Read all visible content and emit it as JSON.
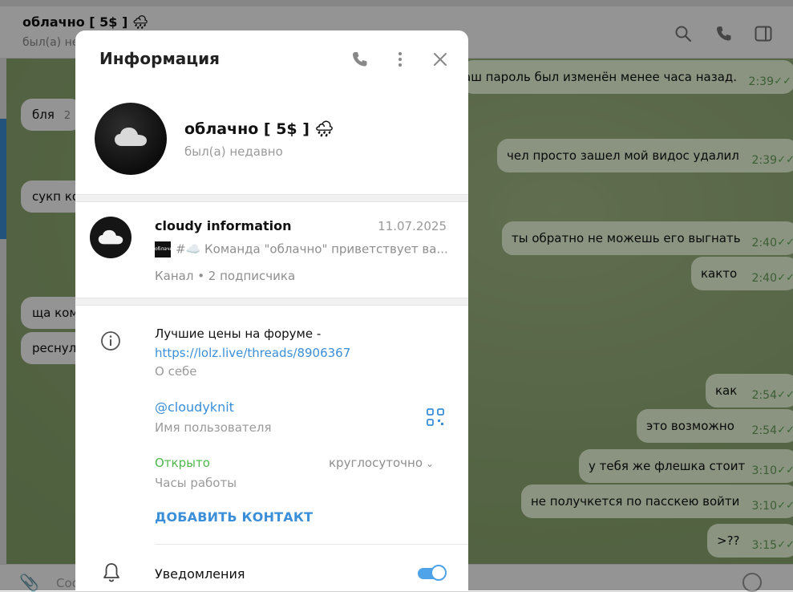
{
  "chat": {
    "title": "облачно [ 5$ ] 🌧",
    "status": "был(а) не",
    "composer_placeholder": "Соо"
  },
  "messages_in": [
    {
      "text": "бля",
      "time": "2"
    },
    {
      "text": "сукп ко",
      "time": ""
    },
    {
      "text": "ща ком",
      "time": ""
    },
    {
      "text": "реснул",
      "time": ""
    }
  ],
  "messages_out": [
    {
      "text": "аш пароль был изменён менее часа назад.",
      "time": "2:39"
    },
    {
      "text": "чел просто зашел мой видос удалил",
      "time": "2:39"
    },
    {
      "text": "ты обратно не можешь его выгнать",
      "time": "2:40"
    },
    {
      "text": "както",
      "time": "2:40"
    },
    {
      "text": "как",
      "time": "2:54"
    },
    {
      "text": "это возможно",
      "time": "2:54"
    },
    {
      "text": "у тебя же флешка стоит",
      "time": "3:10"
    },
    {
      "text": "не получкется по пасскею войти",
      "time": "3:10"
    },
    {
      "text": ">??",
      "time": "3:15"
    }
  ],
  "modal": {
    "title": "Информация",
    "profile": {
      "name": "облачно [ 5$ ] 🌧",
      "status": "был(а) недавно"
    },
    "channel": {
      "name": "cloudy information",
      "date": "11.07.2025",
      "thumb_text": "облачно",
      "preview": "#☁️  Команда \"облачно\" приветствует ва...",
      "meta": "Канал • 2 подписчика"
    },
    "bio": {
      "text": "Лучшие цены на форуме -",
      "link": "https://lolz.live/threads/8906367",
      "label": "О себе"
    },
    "username": {
      "value": "@cloudyknit",
      "label": "Имя пользователя"
    },
    "hours": {
      "status": "Открыто",
      "value": "круглосуточно",
      "label": "Часы работы"
    },
    "add_contact": "ДОБАВИТЬ КОНТАКТ",
    "notifications": {
      "label": "Уведомления",
      "enabled": true
    }
  },
  "colors": {
    "accent": "#3a8fd8",
    "open_green": "#4eb64a",
    "outgoing_bubble": "#eeffde"
  }
}
